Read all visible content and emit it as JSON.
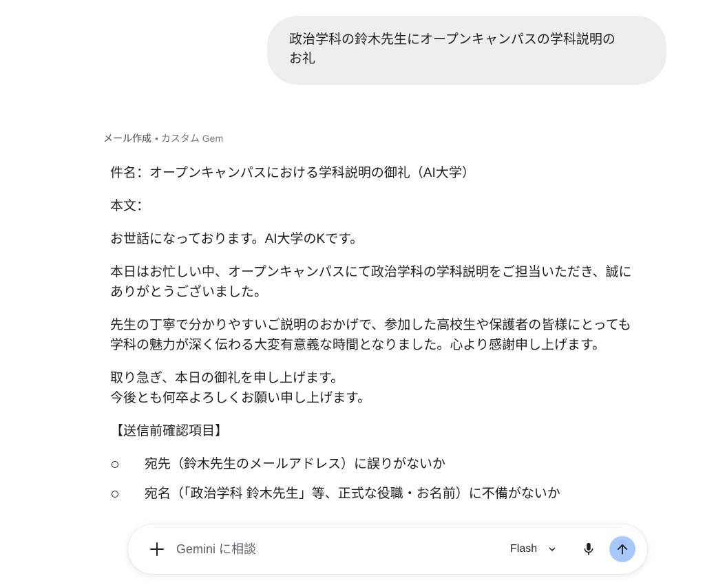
{
  "user_message": {
    "lines": [
      "政治学科の鈴木先生にオープンキャンパスの学科説明の",
      "お礼"
    ]
  },
  "response": {
    "source": {
      "label": "メール作成",
      "separator": "•",
      "gem": "カスタム Gem"
    },
    "subject": "件名：オープンキャンパスにおける学科説明の御礼（AI大学）",
    "body_label": "本文：",
    "paragraphs": [
      [
        "お世話になっております。AI大学のKです。"
      ],
      [
        "本日はお忙しい中、オープンキャンパスにて政治学科の学科説明をご担当いただき、誠に",
        "ありがとうございました。"
      ],
      [
        "先生の丁寧で分かりやすいご説明のおかげで、参加した高校生や保護者の皆様にとっても",
        "学科の魅力が深く伝わる大変有意義な時間となりました。心より感謝申し上げます。"
      ],
      [
        "取り急ぎ、本日の御礼を申し上げます。",
        "今後とも何卒よろしくお願い申し上げます。"
      ]
    ],
    "checklist_heading": "【送信前確認項目】",
    "checklist": [
      "宛先（鈴木先生のメールアドレス）に誤りがないか",
      "宛名（「政治学科 鈴木先生」等、正式な役職・お名前）に不備がないか"
    ]
  },
  "input_bar": {
    "placeholder": "Gemini に相談",
    "model_label": "Flash"
  },
  "icons": {
    "add": "plus-icon",
    "model_menu": "chevron-down-icon",
    "voice": "microphone-icon",
    "send": "arrow-up-icon",
    "list_bullet": "hollow-circle-bullet"
  },
  "colors": {
    "text": "#1f1f1f",
    "muted": "#757575",
    "user_bubble": "#efeeef",
    "send_button": "#a8c7fa"
  }
}
